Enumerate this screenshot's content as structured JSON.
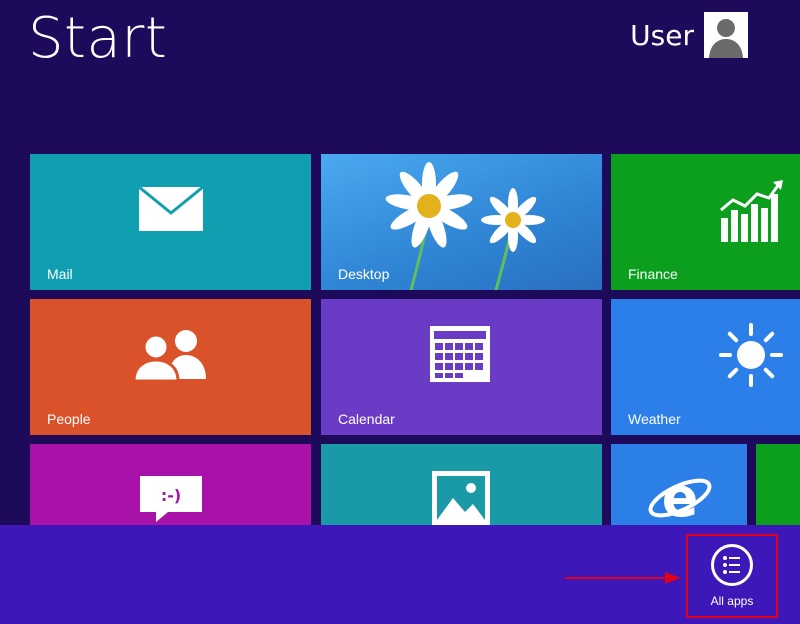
{
  "header": {
    "title": "Start",
    "user_name": "User",
    "avatar_icon": "user-silhouette-icon"
  },
  "tiles": [
    {
      "label": "Mail",
      "icon": "mail-icon",
      "color": "#0f9fb1"
    },
    {
      "label": "Desktop",
      "icon": "desktop-wallpaper",
      "color": "#3a8fd6"
    },
    {
      "label": "Finance",
      "icon": "finance-chart-icon",
      "color": "#0c9e1d"
    },
    {
      "label": "People",
      "icon": "people-icon",
      "color": "#d9522a"
    },
    {
      "label": "Calendar",
      "icon": "calendar-icon",
      "color": "#6a3cc5"
    },
    {
      "label": "Weather",
      "icon": "sun-icon",
      "color": "#2c7fe8"
    },
    {
      "label": "",
      "icon": "messaging-icon",
      "color": "#a812a8"
    },
    {
      "label": "",
      "icon": "photos-icon",
      "color": "#1a9aa6"
    },
    {
      "label": "",
      "icon": "internet-explorer-icon",
      "color": "#2b7fe6"
    },
    {
      "label": "",
      "icon": "",
      "color": "#0c9e1d"
    }
  ],
  "app_bar": {
    "all_apps_label": "All apps",
    "all_apps_icon": "list-icon",
    "highlight_color": "#e0001b"
  }
}
